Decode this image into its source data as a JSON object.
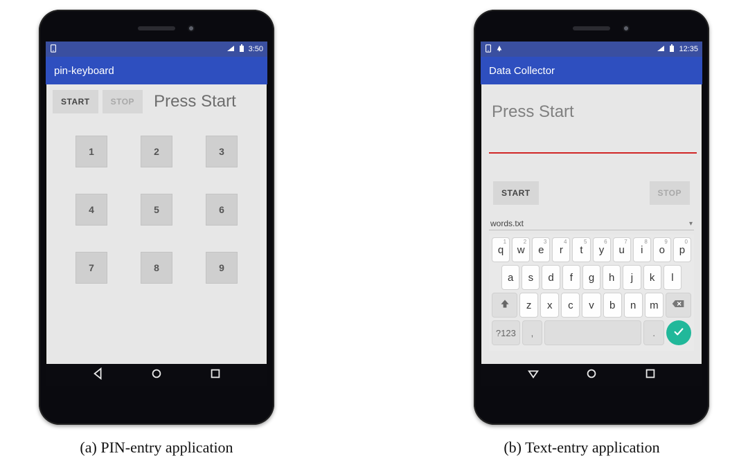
{
  "captions": {
    "a": "(a) PIN-entry application",
    "b": "(b) Text-entry application"
  },
  "left_phone": {
    "status": {
      "time": "3:50"
    },
    "appbar_title": "pin-keyboard",
    "start_label": "START",
    "stop_label": "STOP",
    "hint": "Press Start",
    "keys": {
      "k1": "1",
      "k2": "2",
      "k3": "3",
      "k4": "4",
      "k5": "5",
      "k6": "6",
      "k7": "7",
      "k8": "8",
      "k9": "9"
    }
  },
  "right_phone": {
    "status": {
      "time": "12:35"
    },
    "appbar_title": "Data Collector",
    "hint": "Press Start",
    "input_value": "",
    "start_label": "START",
    "stop_label": "STOP",
    "dropdown": "words.txt",
    "switch_label": "?123",
    "comma": ",",
    "period": ".",
    "row1": {
      "q": "q",
      "w": "w",
      "e": "e",
      "r": "r",
      "t": "t",
      "y": "y",
      "u": "u",
      "i": "i",
      "o": "o",
      "p": "p"
    },
    "row1_sup": {
      "q": "1",
      "w": "2",
      "e": "3",
      "r": "4",
      "t": "5",
      "y": "6",
      "u": "7",
      "i": "8",
      "o": "9",
      "p": "0"
    },
    "row2": {
      "a": "a",
      "s": "s",
      "d": "d",
      "f": "f",
      "g": "g",
      "h": "h",
      "j": "j",
      "k": "k",
      "l": "l"
    },
    "row3": {
      "z": "z",
      "x": "x",
      "c": "c",
      "v": "v",
      "b": "b",
      "n": "n",
      "m": "m"
    }
  }
}
